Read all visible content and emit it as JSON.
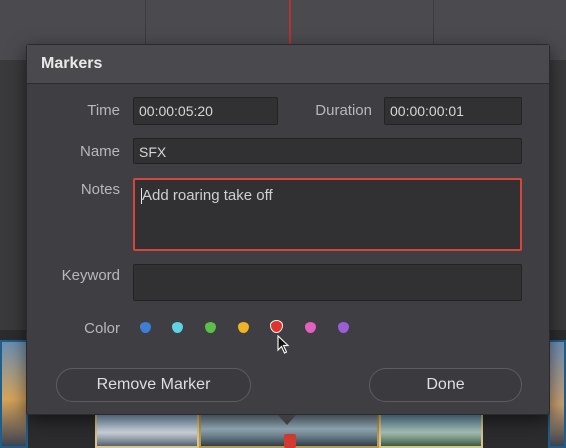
{
  "dialog": {
    "title": "Markers",
    "time_label": "Time",
    "time_value": "00:00:05:20",
    "duration_label": "Duration",
    "duration_value": "00:00:00:01",
    "name_label": "Name",
    "name_value": "SFX",
    "notes_label": "Notes",
    "notes_value": "Add roaring take off",
    "keyword_label": "Keyword",
    "keyword_value": "",
    "color_label": "Color",
    "colors": [
      {
        "name": "blue",
        "hex": "#3e7fd6"
      },
      {
        "name": "cyan",
        "hex": "#5fd3e3"
      },
      {
        "name": "green",
        "hex": "#5cbf4a"
      },
      {
        "name": "yellow",
        "hex": "#f0b324"
      },
      {
        "name": "red",
        "hex": "#e0332b",
        "selected": true
      },
      {
        "name": "pink",
        "hex": "#e35fc0"
      },
      {
        "name": "purple",
        "hex": "#9a5fd6"
      }
    ],
    "remove_button": "Remove Marker",
    "done_button": "Done"
  },
  "timeline": {
    "playhead_color": "#b3332f",
    "marker_color": "#d13b33"
  }
}
